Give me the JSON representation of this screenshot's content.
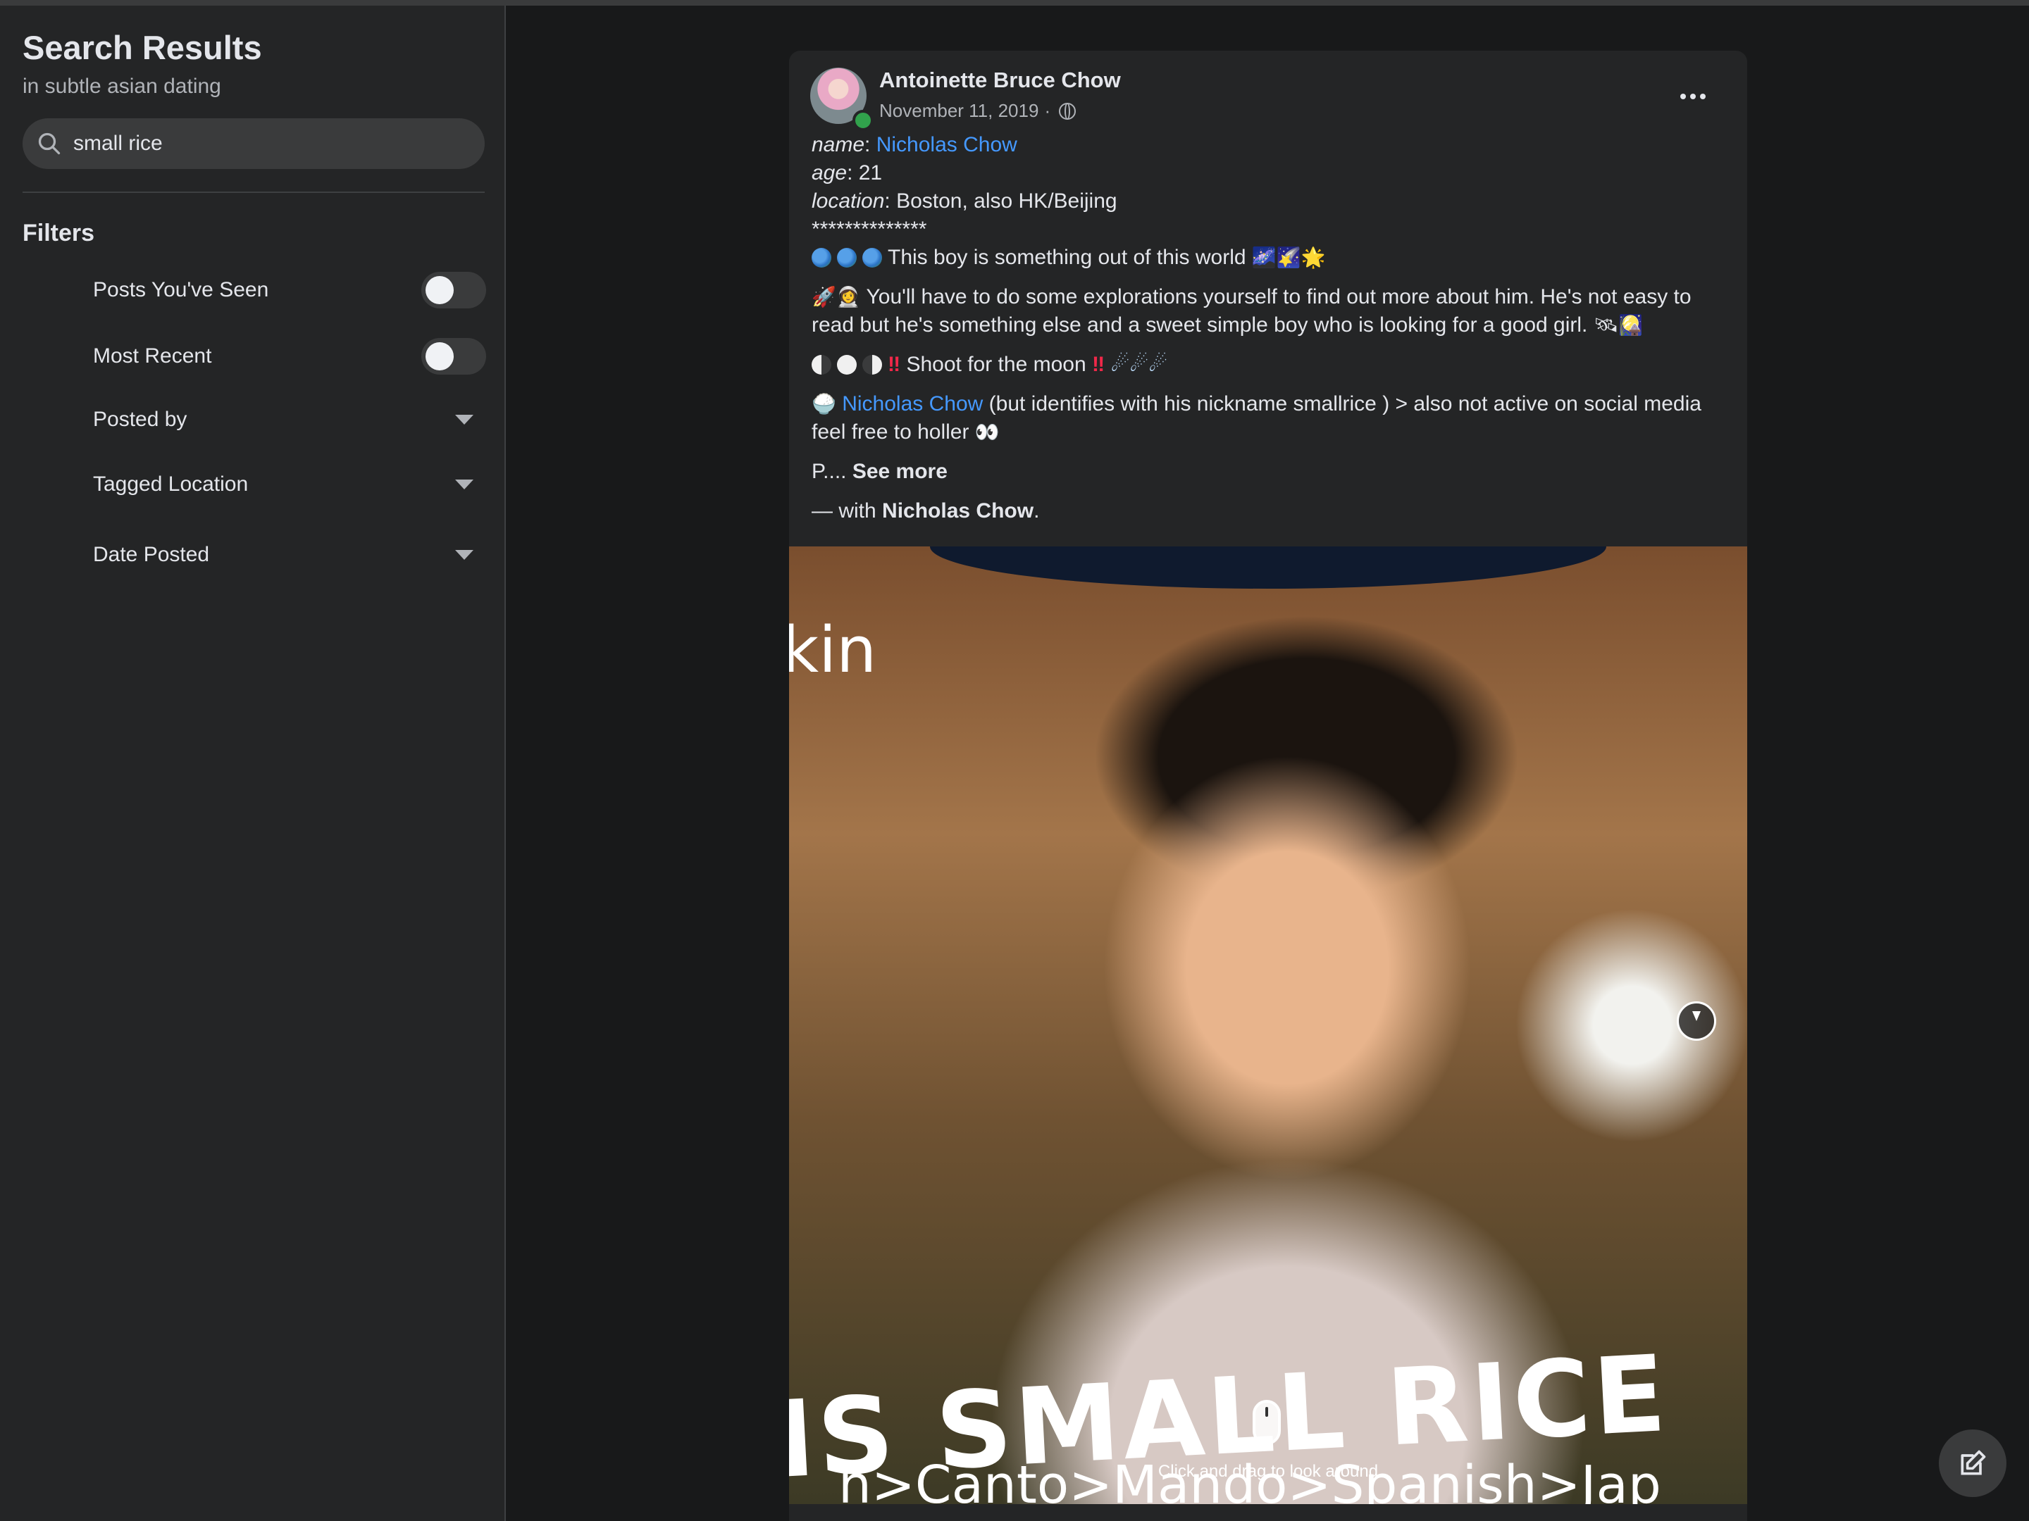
{
  "sidebar": {
    "title": "Search Results",
    "subtitle": "in subtle asian dating",
    "search": {
      "value": "small rice",
      "icon": "search-icon"
    },
    "filters_heading": "Filters",
    "filters": [
      {
        "label": "Posts You've Seen",
        "type": "toggle",
        "on": false
      },
      {
        "label": "Most Recent",
        "type": "toggle",
        "on": false
      },
      {
        "label": "Posted by",
        "type": "dropdown"
      },
      {
        "label": "Tagged Location",
        "type": "dropdown"
      },
      {
        "label": "Date Posted",
        "type": "dropdown"
      }
    ]
  },
  "post": {
    "author": "Antoinette Bruce Chow",
    "date": "November 11, 2019",
    "date_sep": "·",
    "privacy_icon": "globe-icon",
    "more_icon": "more-horizontal-icon",
    "name_key": "name",
    "name_val": "Nicholas Chow",
    "age_key": "age",
    "age_val": "21",
    "location_key": "location",
    "location_val": "Boston, also HK/Beijing",
    "stars": "**************",
    "line_world": "This boy is something out of this world",
    "line_explore": "You'll have to do some explorations yourself to find out more about him. He's not easy to read but he's something else and a sweet simple boy who is looking for a good girl.",
    "line_moon": "Shoot for the moon",
    "tag_name": "Nicholas Chow",
    "line_tag_rest": "(but identifies with his nickname smallrice ) > also not active on social media feel free to holler",
    "see_more_prefix": "P....",
    "see_more": "See more",
    "with_prefix": "— with",
    "with_name": "Nicholas Chow",
    "with_suffix": "."
  },
  "photo": {
    "text_top": "kin",
    "text_big": "IS SMALL RICE",
    "text_langs": "h>Canto>Mando>Spanish>Jap",
    "hint": "Click and drag to look around",
    "icons": [
      "compass-icon",
      "mouse-icon"
    ]
  },
  "compose": {
    "icon": "compose-icon"
  },
  "colors": {
    "background": "#18191a",
    "panel": "#242526",
    "link": "#4599ff",
    "text": "#e4e6eb",
    "muted": "#b0b3b8",
    "online": "#31a24c"
  }
}
